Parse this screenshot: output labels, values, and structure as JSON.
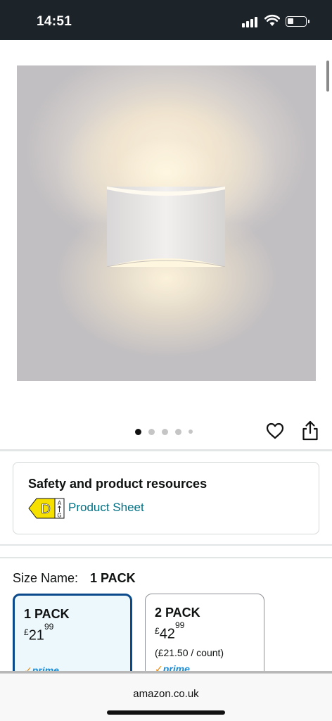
{
  "status_bar": {
    "time": "14:51"
  },
  "gallery": {
    "image_count": 5,
    "active_index": 0
  },
  "safety": {
    "title": "Safety and product resources",
    "energy_class": "D",
    "energy_scale_top": "A",
    "energy_scale_bottom": "G",
    "link_label": "Product Sheet"
  },
  "size": {
    "label": "Size Name:",
    "selected_value": "1 PACK",
    "options": [
      {
        "name": "1 PACK",
        "currency": "£",
        "price_whole": "21",
        "price_fraction": "99",
        "unit_price": "",
        "prime": "prime",
        "selected": true
      },
      {
        "name": "2 PACK",
        "currency": "£",
        "price_whole": "42",
        "price_fraction": "99",
        "unit_price": "(£21.50 / count)",
        "prime": "prime",
        "selected": false
      }
    ]
  },
  "browser": {
    "url": "amazon.co.uk"
  },
  "colors": {
    "link": "#007185",
    "selected_border": "#0a4a8c",
    "selected_bg": "#edf8fd",
    "prime_blue": "#1a8cd8",
    "energy_yellow": "#f6e000"
  }
}
